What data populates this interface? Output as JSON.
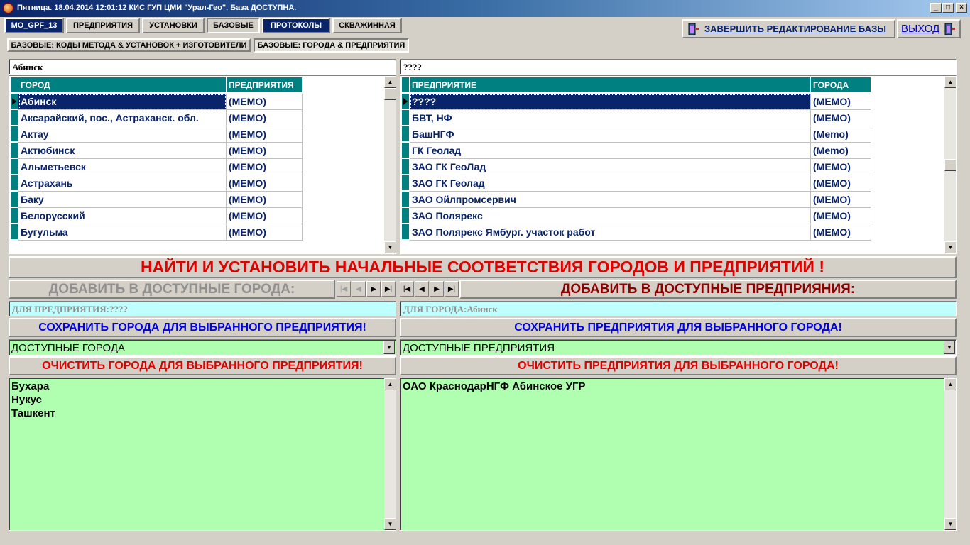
{
  "window": {
    "title": "Пятница. 18.04.2014 12:01:12  КИС ГУП ЦМИ \"Урал-Гео\". База ДОСТУПНА.",
    "minimize": "_",
    "maximize": "□",
    "close": "×"
  },
  "main_tabs": [
    "MO_GPF_13",
    "ПРЕДПРИЯТИЯ",
    "УСТАНОВКИ",
    "БАЗОВЫЕ",
    "ПРОТОКОЛЫ",
    "СКВАЖИННАЯ"
  ],
  "toolbar": {
    "finish_edit": "ЗАВЕРШИТЬ РЕДАКТИРОВАНИЕ БАЗЫ",
    "exit": "ВЫХОД"
  },
  "sub_tabs": [
    "БАЗОВЫЕ: КОДЫ МЕТОДА & УСТАНОВОК + ИЗГОТОВИТЕЛИ",
    "БАЗОВЫЕ: ГОРОДА & ПРЕДПРИЯТИЯ"
  ],
  "left": {
    "search_value": "Абинск",
    "columns": [
      "ГОРОД",
      "ПРЕДПРИЯТИЯ"
    ],
    "rows": [
      [
        "Абинск",
        "(MEMO)"
      ],
      [
        "Аксарайский, пос., Астраханск. обл.",
        "(MEMO)"
      ],
      [
        "Актау",
        "(MEMO)"
      ],
      [
        "Актюбинск",
        "(MEMO)"
      ],
      [
        "Альметьевск",
        "(MEMO)"
      ],
      [
        "Астрахань",
        "(MEMO)"
      ],
      [
        "Баку",
        "(MEMO)"
      ],
      [
        "Белорусский",
        "(MEMO)"
      ],
      [
        "Бугульма",
        "(MEMO)"
      ]
    ],
    "add_label": "ДОБАВИТЬ В ДОСТУПНЫЕ ГОРОДА:",
    "for_label": "ДЛЯ ПРЕДПРИЯТИЯ:????",
    "save_button": "СОХРАНИТЬ ГОРОДА ДЛЯ ВЫБРАННОГО ПРЕДПРИЯТИЯ!",
    "combo_value": "ДОСТУПНЫЕ ГОРОДА",
    "clear_button": "ОЧИСТИТЬ ГОРОДА ДЛЯ ВЫБРАННОГО ПРЕДПРИЯТИЯ!",
    "memo_lines": [
      "Бухара",
      "Нукус",
      "Ташкент"
    ]
  },
  "right": {
    "search_value": "????",
    "columns": [
      "ПРЕДПРИЯТИЕ",
      "ГОРОДА"
    ],
    "rows": [
      [
        "????",
        "(MEMO)"
      ],
      [
        "БВТ, НФ",
        "(MEMO)"
      ],
      [
        "БашНГФ",
        "(Memo)"
      ],
      [
        "ГК Геолад",
        "(Memo)"
      ],
      [
        "ЗАО ГК ГеоЛад",
        "(MEMO)"
      ],
      [
        "ЗАО ГК Геолад",
        "(MEMO)"
      ],
      [
        "ЗАО Ойлпромсервич",
        "(MEMO)"
      ],
      [
        "ЗАО Полярекс",
        "(MEMO)"
      ],
      [
        "ЗАО Полярекс Ямбург. участок работ",
        "(MEMO)"
      ]
    ],
    "add_label": "ДОБАВИТЬ В ДОСТУПНЫЕ ПРЕДПРИЯНИЯ:",
    "for_label": "ДЛЯ ГОРОДА:Абинск",
    "save_button": "СОХРАНИТЬ ПРЕДПРИЯТИЯ ДЛЯ ВЫБРАННОГО ГОРОДА!",
    "combo_value": "ДОСТУПНЫЕ ПРЕДПРИЯТИЯ",
    "clear_button": "ОЧИСТИТЬ ПРЕДПРИЯТИЯ ДЛЯ ВЫБРАННОГО ГОРОДА!",
    "memo_lines": [
      "ОАО КраснодарНГФ Абинское УГР"
    ]
  },
  "find_button": "НАЙТИ И УСТАНОВИТЬ НАЧАЛЬНЫЕ СООТВЕТСТВИЯ ГОРОДОВ И ПРЕДПРИЯТИЙ !",
  "nav_glyphs": [
    "|◀",
    "◀",
    "▶",
    "▶|"
  ],
  "colors": {
    "teal_header": "#008080",
    "navy_text": "#0a246a",
    "red_text": "#e00000",
    "blue_text": "#0000e0",
    "green_field": "#b0ffb0",
    "cyan_field": "#c0ffff"
  }
}
